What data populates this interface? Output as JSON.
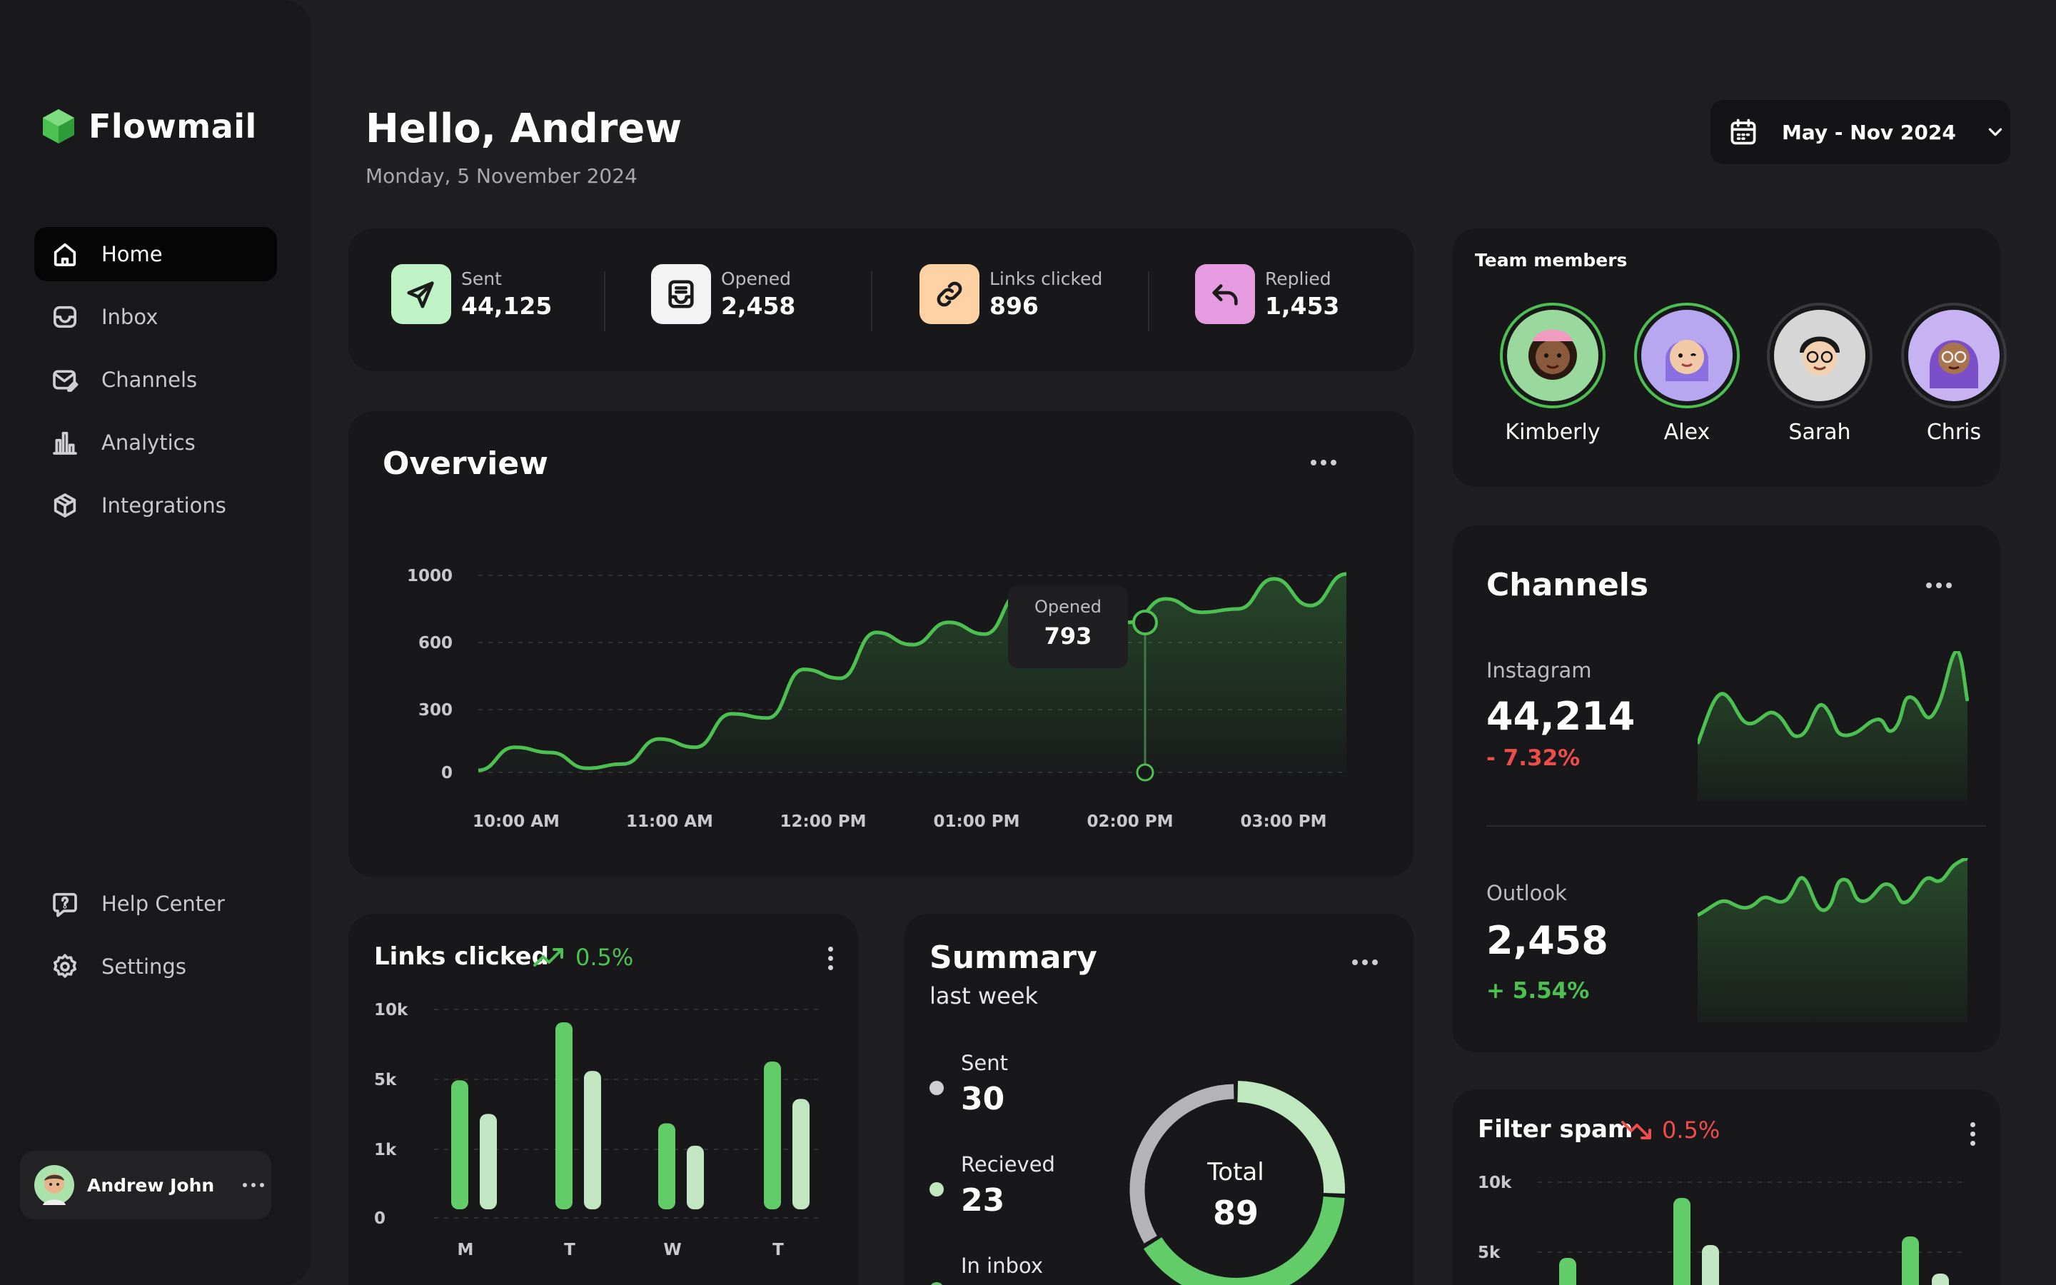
{
  "app": {
    "name": "Flowmail",
    "brand_color": "#4cc152"
  },
  "sidebar": {
    "nav": [
      {
        "label": "Home",
        "icon": "home-icon",
        "active": true
      },
      {
        "label": "Inbox",
        "icon": "inbox-icon"
      },
      {
        "label": "Channels",
        "icon": "mail-edit-icon"
      },
      {
        "label": "Analytics",
        "icon": "bar-chart-icon"
      },
      {
        "label": "Integrations",
        "icon": "cube-icon"
      }
    ],
    "bottom": [
      {
        "label": "Help Center",
        "icon": "help-chat-icon"
      },
      {
        "label": "Settings",
        "icon": "gear-icon"
      }
    ],
    "user": {
      "name": "Andrew John"
    }
  },
  "header": {
    "greeting": "Hello, Andrew",
    "date": "Monday, 5 November 2024",
    "date_range": "May - Nov 2024"
  },
  "stats": [
    {
      "label": "Sent",
      "value": "44,125",
      "icon": "send-icon",
      "color": "#bff2c4"
    },
    {
      "label": "Opened",
      "value": "2,458",
      "icon": "inbox-tray-icon",
      "color": "#f3f3f3"
    },
    {
      "label": "Links clicked",
      "value": "896",
      "icon": "link-icon",
      "color": "#ffd2a6"
    },
    {
      "label": "Replied",
      "value": "1,453",
      "icon": "reply-icon",
      "color": "#e69be0"
    }
  ],
  "overview": {
    "title": "Overview",
    "tooltip": {
      "label": "Opened",
      "value": "793"
    }
  },
  "chart_data": [
    {
      "type": "area",
      "title": "Overview",
      "y_ticks": [
        "1000",
        "600",
        "300",
        "0"
      ],
      "x_ticks": [
        "10:00 AM",
        "11:00 AM",
        "12:00 PM",
        "01:00 PM",
        "02:00 PM",
        "03:00 PM"
      ],
      "series": [
        {
          "values": [
            10,
            120,
            95,
            20,
            40,
            160,
            120,
            280,
            260,
            480,
            440,
            660,
            590,
            720,
            650,
            900,
            600,
            820,
            720,
            860,
            780,
            800,
            980,
            820,
            1010
          ]
        }
      ],
      "color": "#4cc152"
    },
    {
      "type": "bar",
      "title": "Links clicked",
      "y_ticks": [
        "10k",
        "5k",
        "1k",
        "0"
      ],
      "categories": [
        "M",
        "T",
        "W",
        "T"
      ],
      "series": [
        {
          "values": [
            0.69,
            1.0,
            0.46,
            0.79
          ]
        },
        {
          "values": [
            0.51,
            0.74,
            0.34,
            0.59
          ]
        }
      ],
      "colors": [
        "#62cc68",
        "#c3e6c2"
      ]
    },
    {
      "type": "pie",
      "title": "Summary",
      "values": [
        30,
        23,
        36
      ],
      "colors": [
        "#b4b4b8",
        "#bfe8be",
        "#62cc68"
      ]
    },
    {
      "type": "bar",
      "title": "Filter spam",
      "y_ticks": [
        "10k",
        "5k"
      ],
      "colors": [
        "#62cc68",
        "#c3e6c2"
      ]
    }
  ],
  "team": {
    "title": "Team members",
    "members": [
      {
        "name": "Kimberly",
        "color": "#9ad99d"
      },
      {
        "name": "Alex",
        "color": "#b7a6f0"
      },
      {
        "name": "Sarah",
        "color": "#d6d6d6"
      },
      {
        "name": "Chris",
        "color": "#c7b2f2"
      }
    ]
  },
  "channels": {
    "title": "Channels",
    "items": [
      {
        "name": "Instagram",
        "value": "44,214",
        "change": "- 7.32%",
        "color": "#ef4c4c"
      },
      {
        "name": "Outlook",
        "value": "2,458",
        "change": "+ 5.54%",
        "color": "#4cc152"
      }
    ]
  },
  "links_clicked": {
    "title": "Links clicked",
    "change": "0.5%"
  },
  "summary": {
    "title": "Summary",
    "subtitle": "last week",
    "items": [
      {
        "label": "Sent",
        "value": "30"
      },
      {
        "label": "Recieved",
        "value": "23"
      },
      {
        "label": "In inbox",
        "value": ""
      }
    ],
    "total_label": "Total",
    "total_value": "89"
  },
  "filter_spam": {
    "title": "Filter spam",
    "change": "0.5%"
  }
}
